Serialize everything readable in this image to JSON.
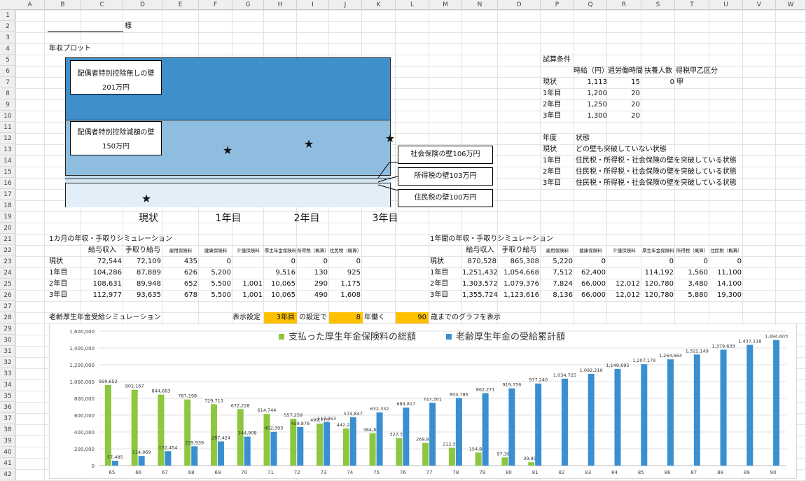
{
  "columns": [
    "A",
    "B",
    "C",
    "D",
    "E",
    "F",
    "G",
    "H",
    "I",
    "J",
    "K",
    "L",
    "M",
    "N",
    "O",
    "P",
    "Q",
    "R",
    "S",
    "T",
    "U",
    "V",
    "W"
  ],
  "rows": [
    "1",
    "2",
    "3",
    "4",
    "5",
    "6",
    "7",
    "8",
    "9",
    "10",
    "11",
    "12",
    "13",
    "14",
    "15",
    "16",
    "17",
    "18",
    "19",
    "20",
    "21",
    "22",
    "23",
    "24",
    "25",
    "26",
    "27",
    "28",
    "29",
    "30",
    "31",
    "32",
    "33",
    "34",
    "35",
    "36",
    "37",
    "38",
    "39",
    "40",
    "41",
    "42"
  ],
  "honorific": "様",
  "plot_title": "年収プロット",
  "walls": {
    "w201_title": "配偶者特別控除無しの壁",
    "w201_amount": "201万円",
    "w150_title": "配偶者特別控除減額の壁",
    "w150_amount": "150万円",
    "w106": "社会保険の壁106万円",
    "w103": "所得税の壁103万円",
    "w100": "住民税の壁100万円"
  },
  "plot_years": [
    "現状",
    "1年目",
    "2年目",
    "3年目"
  ],
  "star": "★",
  "cond": {
    "title": "試算条件",
    "headers": [
      "時給（円）",
      "週労働時間",
      "扶養人数",
      "得税甲乙区分"
    ],
    "rows": [
      {
        "label": "現状",
        "wage": "1,113",
        "hours": "15",
        "dep": "0",
        "cls": "甲"
      },
      {
        "label": "1年目",
        "wage": "1,200",
        "hours": "20",
        "dep": "",
        "cls": ""
      },
      {
        "label": "2年目",
        "wage": "1,250",
        "hours": "20",
        "dep": "",
        "cls": ""
      },
      {
        "label": "3年目",
        "wage": "1,300",
        "hours": "20",
        "dep": "",
        "cls": ""
      }
    ]
  },
  "status": {
    "h_year": "年度",
    "h_state": "状態",
    "rows": [
      {
        "label": "現状",
        "text": "どの壁も突破していない状態"
      },
      {
        "label": "1年目",
        "text": "住民税・所得税・社会保険の壁を突破している状態"
      },
      {
        "label": "2年目",
        "text": "住民税・所得税・社会保険の壁を突破している状態"
      },
      {
        "label": "3年目",
        "text": "住民税・所得税・社会保険の壁を突破している状態"
      }
    ]
  },
  "monthly": {
    "title": "1カ月の年収・手取りシミュレーション",
    "headers": [
      "給与収入",
      "手取り給与",
      "雇用保険料",
      "健康保険料",
      "介護保険料",
      "厚生年金保険料",
      "所得税（概算）",
      "住民税（概算）"
    ],
    "rows": [
      {
        "label": "現状",
        "v": [
          "72,544",
          "72,109",
          "435",
          "0",
          "",
          "0",
          "0",
          "0"
        ]
      },
      {
        "label": "1年目",
        "v": [
          "104,286",
          "87,889",
          "626",
          "5,200",
          "",
          "9,516",
          "130",
          "925"
        ]
      },
      {
        "label": "2年目",
        "v": [
          "108,631",
          "89,948",
          "652",
          "5,500",
          "1,001",
          "10,065",
          "290",
          "1,175"
        ]
      },
      {
        "label": "3年目",
        "v": [
          "112,977",
          "93,635",
          "678",
          "5,500",
          "1,001",
          "10,065",
          "490",
          "1,608"
        ]
      }
    ]
  },
  "annual": {
    "title": "1年間の年収・手取りシミュレーション",
    "headers": [
      "給与収入",
      "手取り給与",
      "雇用保険料",
      "健康保険料",
      "介護保険料",
      "厚生年金保険料",
      "所得税（概算）",
      "住民税（概算）"
    ],
    "rows": [
      {
        "label": "現状",
        "v": [
          "870,528",
          "865,308",
          "5,220",
          "0",
          "",
          "0",
          "0",
          "0"
        ]
      },
      {
        "label": "1年目",
        "v": [
          "1,251,432",
          "1,054,668",
          "7,512",
          "62,400",
          "",
          "114,192",
          "1,560",
          "11,100"
        ]
      },
      {
        "label": "2年目",
        "v": [
          "1,303,572",
          "1,079,376",
          "7,824",
          "66,000",
          "12,012",
          "120,780",
          "3,480",
          "14,100"
        ]
      },
      {
        "label": "3年目",
        "v": [
          "1,355,724",
          "1,123,616",
          "8,136",
          "66,000",
          "12,012",
          "120,780",
          "5,880",
          "19,300"
        ]
      }
    ]
  },
  "pension": {
    "title": "老齢厚生年金受給シミュレーション",
    "display": "表示設定",
    "year_val": "3年目",
    "setting_text": "の設定で",
    "work_val": "8",
    "work_text": "年働く",
    "age_val": "90",
    "age_text": "歳までのグラフを表示"
  },
  "chart_data": {
    "type": "bar",
    "categories": [
      "65",
      "66",
      "67",
      "68",
      "69",
      "70",
      "71",
      "72",
      "73",
      "74",
      "75",
      "76",
      "77",
      "78",
      "79",
      "80",
      "81",
      "82",
      "83",
      "84",
      "85",
      "86",
      "87",
      "88",
      "89",
      "90"
    ],
    "series": [
      {
        "name": "支払った厚生年金保険料の総額",
        "color": "#8dc63f",
        "values": [
          959652,
          902167,
          844683,
          787198,
          729713,
          672228,
          614744,
          557259,
          499775,
          442290,
          384805,
          327320,
          269835,
          212351,
          154866,
          97381,
          39896,
          0,
          0,
          0,
          0,
          0,
          0,
          0,
          0,
          0
        ]
      },
      {
        "name": "老齢厚生年金の受給累計額",
        "color": "#3a8fd0",
        "values": [
          57485,
          114969,
          172454,
          229939,
          287424,
          344908,
          402393,
          459878,
          517363,
          574847,
          632332,
          689817,
          747301,
          804786,
          862271,
          919756,
          977240,
          1034725,
          1092210,
          1149695,
          1207179,
          1264664,
          1322149,
          1379633,
          1437118,
          1494603
        ]
      }
    ],
    "ylim": [
      0,
      1600000
    ],
    "yticks": [
      "0",
      "200,000",
      "400,000",
      "600,000",
      "800,000",
      "1,000,000",
      "1,200,000",
      "1,400,000",
      "1,600,000"
    ],
    "grid": true,
    "legend": "top"
  }
}
